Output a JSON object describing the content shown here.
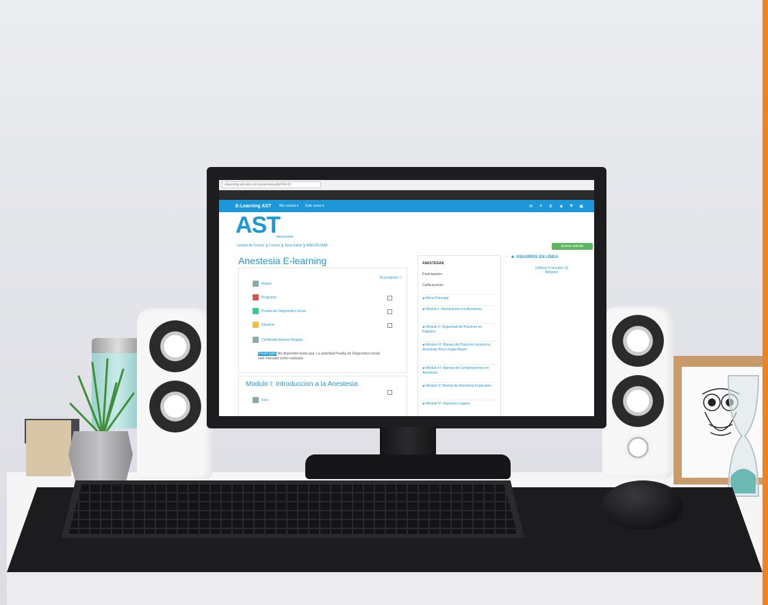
{
  "browser": {
    "url": "elearning.ast.edu.co/course/view.php?id=13"
  },
  "site": {
    "brand": "E-Learning AST",
    "menu_courses": "Mis cursos ▾",
    "menu_this_course": "Este curso ▾",
    "logo": "AST",
    "logo_sub": "EDUCACION"
  },
  "breadcrumb": "Listado de Cursos ❯ Cursos ❯ Área Salud ❯ ANESTESIAE",
  "edit_button": "Activar edición",
  "course": {
    "title": "Anestesia E-learning",
    "progress_label": "Su progreso",
    "activities": [
      "Avisos",
      "Programa",
      "Prueba de Diagnostico Inicial",
      "Glosario",
      "Certificado Alumno Regular"
    ],
    "restriction_hl": "Restringido",
    "restriction_text": "No disponible hasta que: La actividad Prueba de Diagnostico Inicial esté marcada como realizada"
  },
  "module1": {
    "title": "Modulo I: Introduccion a la Anestesia",
    "first_item": "Foro"
  },
  "sidebar": {
    "heading": "ANESTESIAE",
    "items": [
      "Participantes",
      "Calificaciones"
    ],
    "modules": [
      "Menú Principal",
      "Modulo I: Introduccion a la Anestesia",
      "Modulo II: Seguridad del Paciente en Pabellon",
      "Modulo III: Manejo del Paciente durante la Anestesia Para cirugia Mayor",
      "Modulo IV: Manejo de Complicaciones en Anestesia",
      "Modulo V: Manejo de Anestesia Especiales",
      "Modulo VI: Aspectos Legales"
    ]
  },
  "online": {
    "title": "USUARIOS EN LÍNEA",
    "text": "(últimos 5 minutos: 0) Ninguno"
  }
}
